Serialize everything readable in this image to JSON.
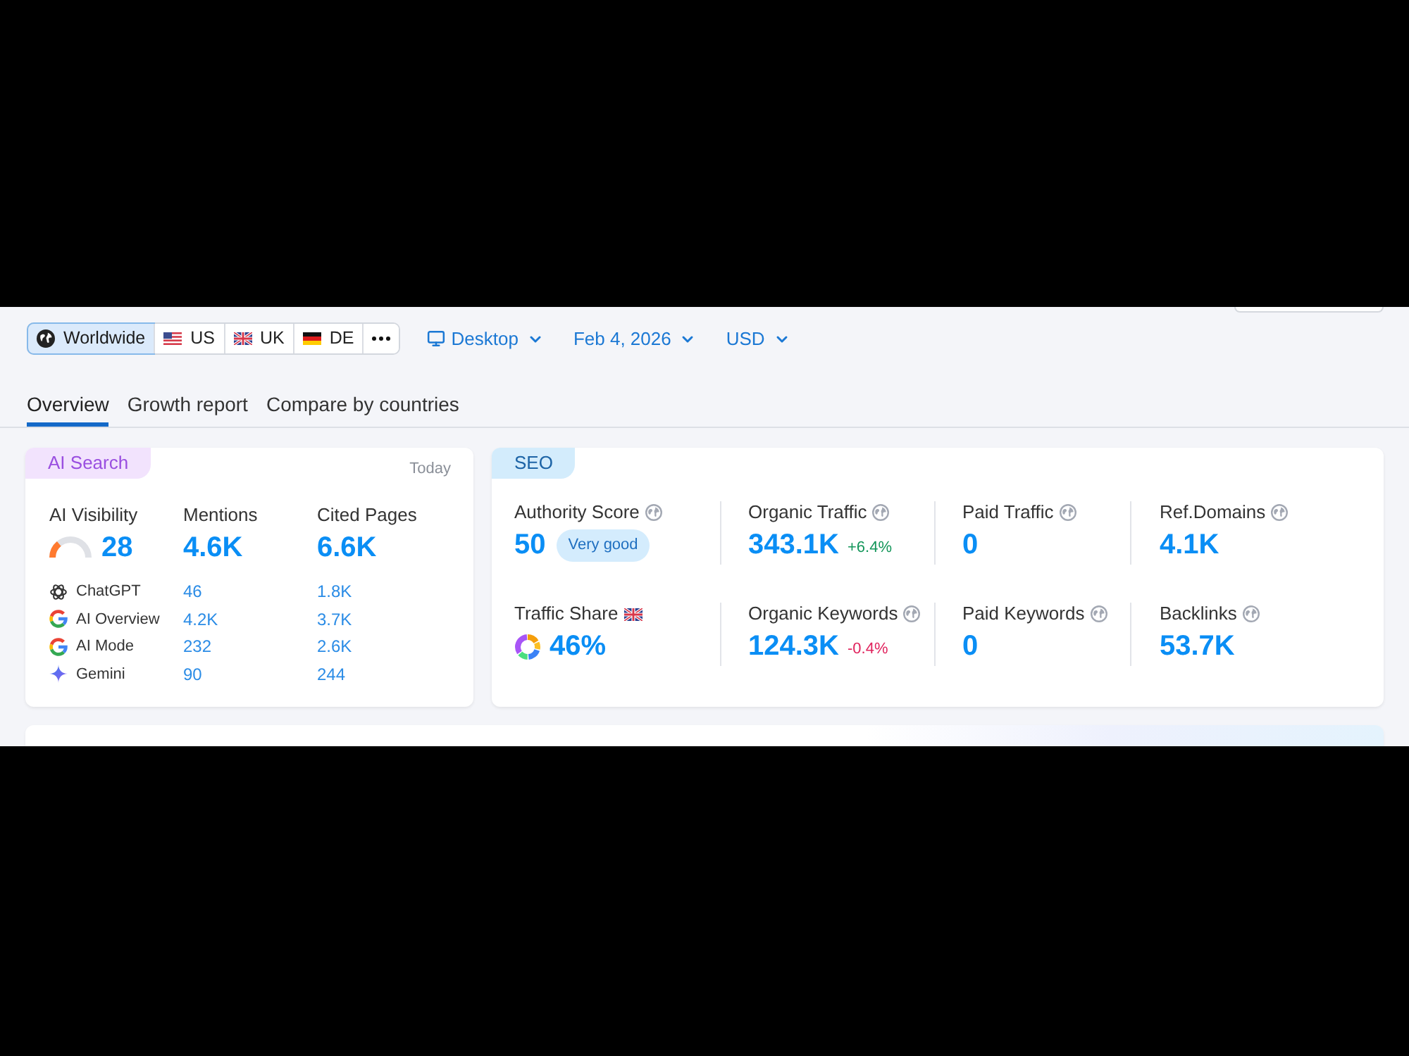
{
  "location_filter": [
    {
      "kind": "globe",
      "label": "Worldwide",
      "selected": true
    },
    {
      "kind": "us",
      "label": "US",
      "selected": false
    },
    {
      "kind": "uk",
      "label": "UK",
      "selected": false
    },
    {
      "kind": "de",
      "label": "DE",
      "selected": false
    },
    {
      "kind": "more",
      "selected": false
    }
  ],
  "dropdowns": [
    {
      "kind": "device",
      "label": "Desktop"
    },
    {
      "kind": "date",
      "label": "Feb 4, 2026"
    },
    {
      "kind": "currency",
      "label": "USD"
    }
  ],
  "tabs": [
    {
      "label": "Overview",
      "selected": true
    },
    {
      "label": "Growth report",
      "selected": false
    },
    {
      "label": "Compare by countries",
      "selected": false
    }
  ],
  "ai_search": {
    "tag": "AI Search",
    "period": "Today",
    "metrics": [
      {
        "kind": "gauge",
        "label": "AI Visibility",
        "value": "28",
        "level": 0.28
      },
      {
        "kind": "plain",
        "label": "Mentions",
        "value": "4.6K"
      },
      {
        "kind": "plain",
        "label": "Cited Pages",
        "value": "6.6K"
      }
    ],
    "platforms": [
      {
        "kind": "knot",
        "name": "ChatGPT",
        "mentions": "46",
        "cited_pages": "1.8K"
      },
      {
        "kind": "g",
        "name": "AI Overview",
        "mentions": "4.2K",
        "cited_pages": "3.7K"
      },
      {
        "kind": "g",
        "name": "AI Mode",
        "mentions": "232",
        "cited_pages": "2.6K"
      },
      {
        "kind": "sparkle",
        "name": "Gemini",
        "mentions": "90",
        "cited_pages": "244"
      }
    ]
  },
  "seo": {
    "tag": "SEO",
    "metrics": [
      {
        "kind": "score",
        "label": "Authority Score",
        "value": "50",
        "badge": "Very good"
      },
      {
        "kind": "stat",
        "label": "Organic Traffic",
        "value": "343.1K",
        "change": "+6.4%",
        "positive": true
      },
      {
        "kind": "stat",
        "label": "Paid Traffic",
        "value": "0"
      },
      {
        "kind": "stat",
        "label": "Ref.Domains",
        "value": "4.1K"
      },
      {
        "kind": "share",
        "label": "Traffic Share",
        "value": "46%"
      },
      {
        "kind": "stat",
        "label": "Organic Keywords",
        "value": "124.3K",
        "change": "-0.4%",
        "positive": false
      },
      {
        "kind": "stat",
        "label": "Paid Keywords",
        "value": "0"
      },
      {
        "kind": "stat",
        "label": "Backlinks",
        "value": "53.7K"
      }
    ]
  }
}
